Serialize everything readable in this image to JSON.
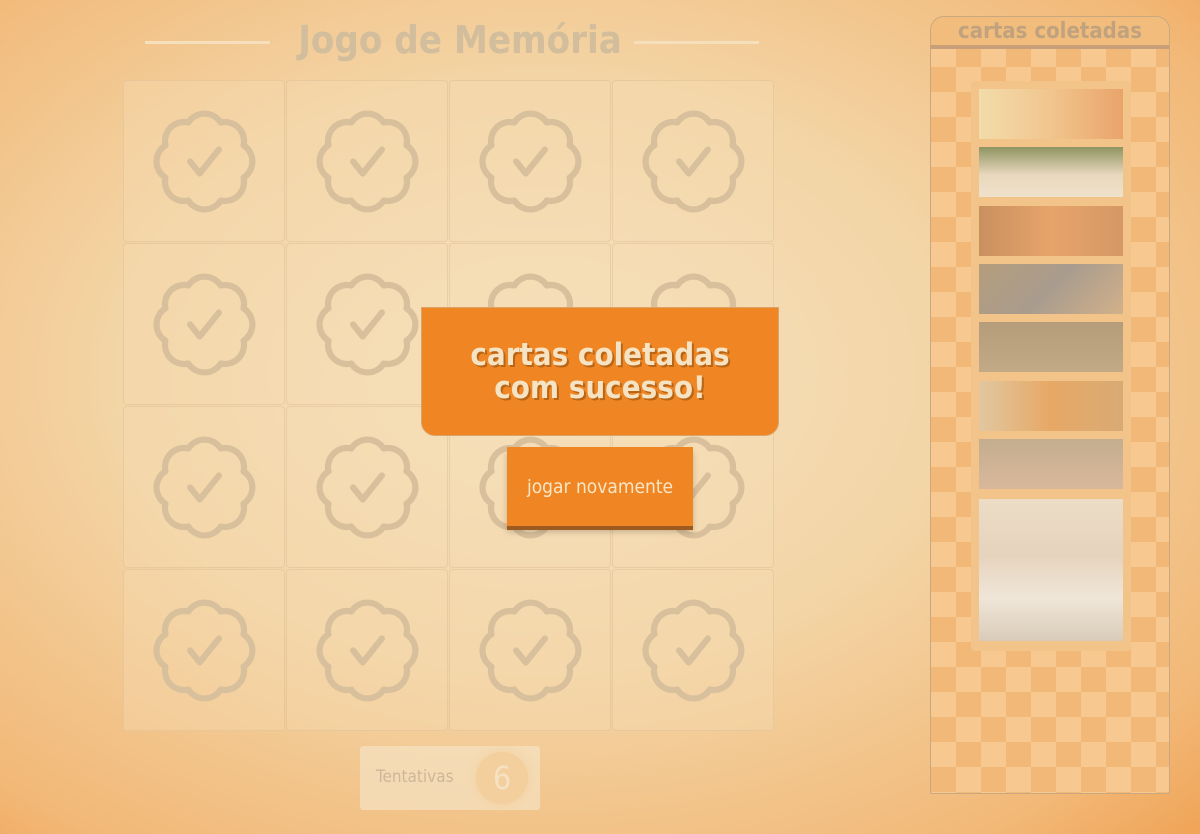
{
  "header": {
    "title": "Jogo de Memória"
  },
  "board": {
    "cards": [
      {
        "state": "matched"
      },
      {
        "state": "matched"
      },
      {
        "state": "matched"
      },
      {
        "state": "matched"
      },
      {
        "state": "matched"
      },
      {
        "state": "matched"
      },
      {
        "state": "matched"
      },
      {
        "state": "matched"
      },
      {
        "state": "matched"
      },
      {
        "state": "matched"
      },
      {
        "state": "matched"
      },
      {
        "state": "matched"
      },
      {
        "state": "matched"
      },
      {
        "state": "matched"
      },
      {
        "state": "matched"
      },
      {
        "state": "matched"
      }
    ],
    "card_icon": "badge-check-icon"
  },
  "attempts": {
    "label": "Tentativas",
    "value": "6"
  },
  "sidebar": {
    "title": "cartas coletadas",
    "photos": [
      "cat-photo-1",
      "cat-photo-2",
      "cat-photo-3",
      "cat-photo-4",
      "cat-photo-5",
      "cat-photo-6",
      "cat-photo-7",
      "cat-photo-8"
    ]
  },
  "modal": {
    "line1": "cartas coletadas",
    "line2": "com sucesso!",
    "button": "jogar novamente"
  },
  "colors": {
    "accent": "#f08623"
  }
}
